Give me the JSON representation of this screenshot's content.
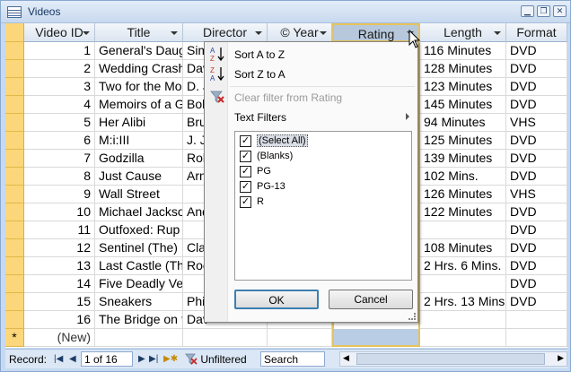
{
  "window": {
    "title": "Videos"
  },
  "columns": [
    {
      "label": "Video ID"
    },
    {
      "label": "Title"
    },
    {
      "label": "Director"
    },
    {
      "label": "© Year"
    },
    {
      "label": "Rating"
    },
    {
      "label": "Length"
    },
    {
      "label": "Format"
    }
  ],
  "rows": [
    {
      "id": "1",
      "title": "General's Daug",
      "director": "Sim",
      "length": "116 Minutes",
      "format": "DVD"
    },
    {
      "id": "2",
      "title": "Wedding Crash",
      "director": "Dav",
      "length": "128 Minutes",
      "format": "DVD"
    },
    {
      "id": "3",
      "title": "Two for the Mo",
      "director": "D. J",
      "length": "123 Minutes",
      "format": "DVD"
    },
    {
      "id": "4",
      "title": "Memoirs of a G",
      "director": "Bob",
      "length": "145 Minutes",
      "format": "DVD"
    },
    {
      "id": "5",
      "title": "Her Alibi",
      "director": "Bru",
      "length": "94 Minutes",
      "format": "VHS"
    },
    {
      "id": "6",
      "title": "M:i:III",
      "director": "J. J.",
      "length": "125 Minutes",
      "format": "DVD"
    },
    {
      "id": "7",
      "title": "Godzilla",
      "director": "Rol",
      "length": "139 Minutes",
      "format": "DVD"
    },
    {
      "id": "8",
      "title": "Just Cause",
      "director": "Arn",
      "length": "102 Mins.",
      "format": "DVD"
    },
    {
      "id": "9",
      "title": "Wall Street",
      "director": "",
      "length": "126 Minutes",
      "format": "VHS"
    },
    {
      "id": "10",
      "title": "Michael Jackso",
      "director": "And",
      "length": "122 Minutes",
      "format": "DVD"
    },
    {
      "id": "11",
      "title": "Outfoxed: Rup",
      "director": "",
      "length": "",
      "format": "DVD"
    },
    {
      "id": "12",
      "title": "Sentinel (The)",
      "director": "Cla",
      "length": "108 Minutes",
      "format": "DVD"
    },
    {
      "id": "13",
      "title": "Last Castle (The",
      "director": "Roc",
      "length": "2 Hrs. 6 Mins.",
      "format": "DVD"
    },
    {
      "id": "14",
      "title": "Five Deadly Ve",
      "director": "",
      "length": "",
      "format": "DVD"
    },
    {
      "id": "15",
      "title": "Sneakers",
      "director": "Phi",
      "length": "2 Hrs. 13 Mins.",
      "format": "DVD"
    },
    {
      "id": "16",
      "title": "The Bridge on t",
      "director": "Dav",
      "length": "",
      "format": ""
    }
  ],
  "new_row": {
    "marker": "*",
    "label": "(New)"
  },
  "filter_menu": {
    "sort_asc": "Sort A to Z",
    "sort_desc": "Sort Z to A",
    "clear_filter": "Clear filter from Rating",
    "text_filters": "Text Filters",
    "options": [
      {
        "label": "(Select All)",
        "checked": true
      },
      {
        "label": "(Blanks)",
        "checked": true
      },
      {
        "label": "PG",
        "checked": true
      },
      {
        "label": "PG-13",
        "checked": true
      },
      {
        "label": "R",
        "checked": true
      }
    ],
    "ok": "OK",
    "cancel": "Cancel"
  },
  "statusbar": {
    "record_label": "Record:",
    "record_value": "1 of 16",
    "filter_status": "Unfiltered",
    "search_placeholder": "Search"
  },
  "icons": {
    "sort_asc": "sort-ascending-icon",
    "sort_desc": "sort-descending-icon",
    "clear_filter": "clear-filter-icon",
    "new_record": "new-record-icon"
  },
  "colors": {
    "selector": "#fbd67a",
    "active_column_border": "#e7c35a",
    "header": "#dbe5f1"
  }
}
